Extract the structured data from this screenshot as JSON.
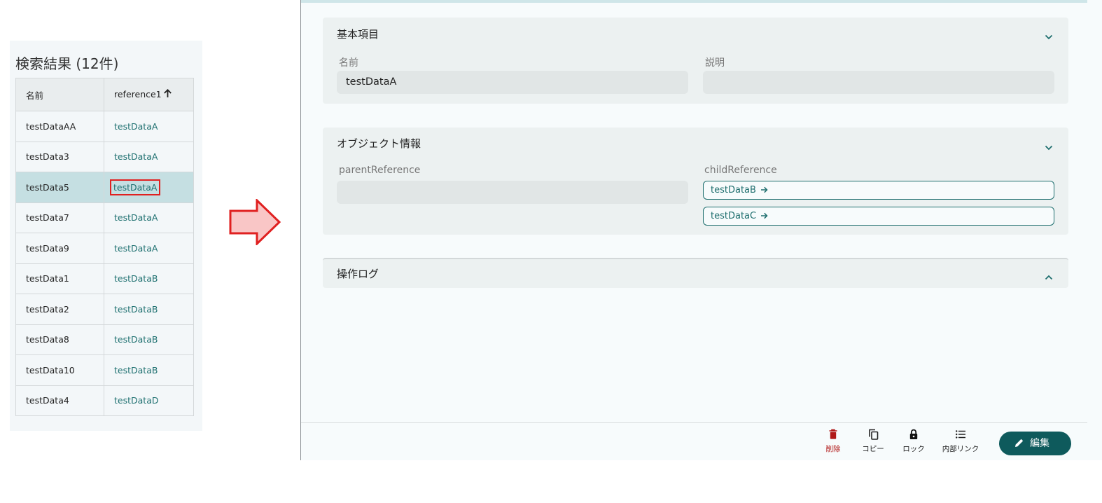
{
  "search": {
    "title": "検索結果 (12件)",
    "columns": {
      "name": "名前",
      "reference": "reference1"
    },
    "rows": [
      {
        "name": "testDataAA",
        "reference": "testDataA"
      },
      {
        "name": "testData3",
        "reference": "testDataA"
      },
      {
        "name": "testData5",
        "reference": "testDataA",
        "selected": true
      },
      {
        "name": "testData7",
        "reference": "testDataA"
      },
      {
        "name": "testData9",
        "reference": "testDataA"
      },
      {
        "name": "testData1",
        "reference": "testDataB"
      },
      {
        "name": "testData2",
        "reference": "testDataB"
      },
      {
        "name": "testData8",
        "reference": "testDataB"
      },
      {
        "name": "testData10",
        "reference": "testDataB"
      },
      {
        "name": "testData4",
        "reference": "testDataD"
      }
    ]
  },
  "detail": {
    "basic": {
      "title": "基本項目",
      "name_label": "名前",
      "name_value": "testDataA",
      "desc_label": "説明",
      "desc_value": ""
    },
    "object": {
      "title": "オブジェクト情報",
      "parent_label": "parentReference",
      "parent_value": "",
      "child_label": "childReference",
      "children": [
        "testDataB",
        "testDataC"
      ]
    },
    "log": {
      "title": "操作ログ"
    }
  },
  "footer": {
    "delete_label": "削除",
    "copy_label": "コピー",
    "lock_label": "ロック",
    "links_label": "内部リンク",
    "edit_label": "編集"
  },
  "colors": {
    "accent": "#0e5a5c",
    "link": "#1e7070",
    "selected_row": "#c5dfe2",
    "highlight": "#e02020",
    "danger": "#b01818"
  }
}
